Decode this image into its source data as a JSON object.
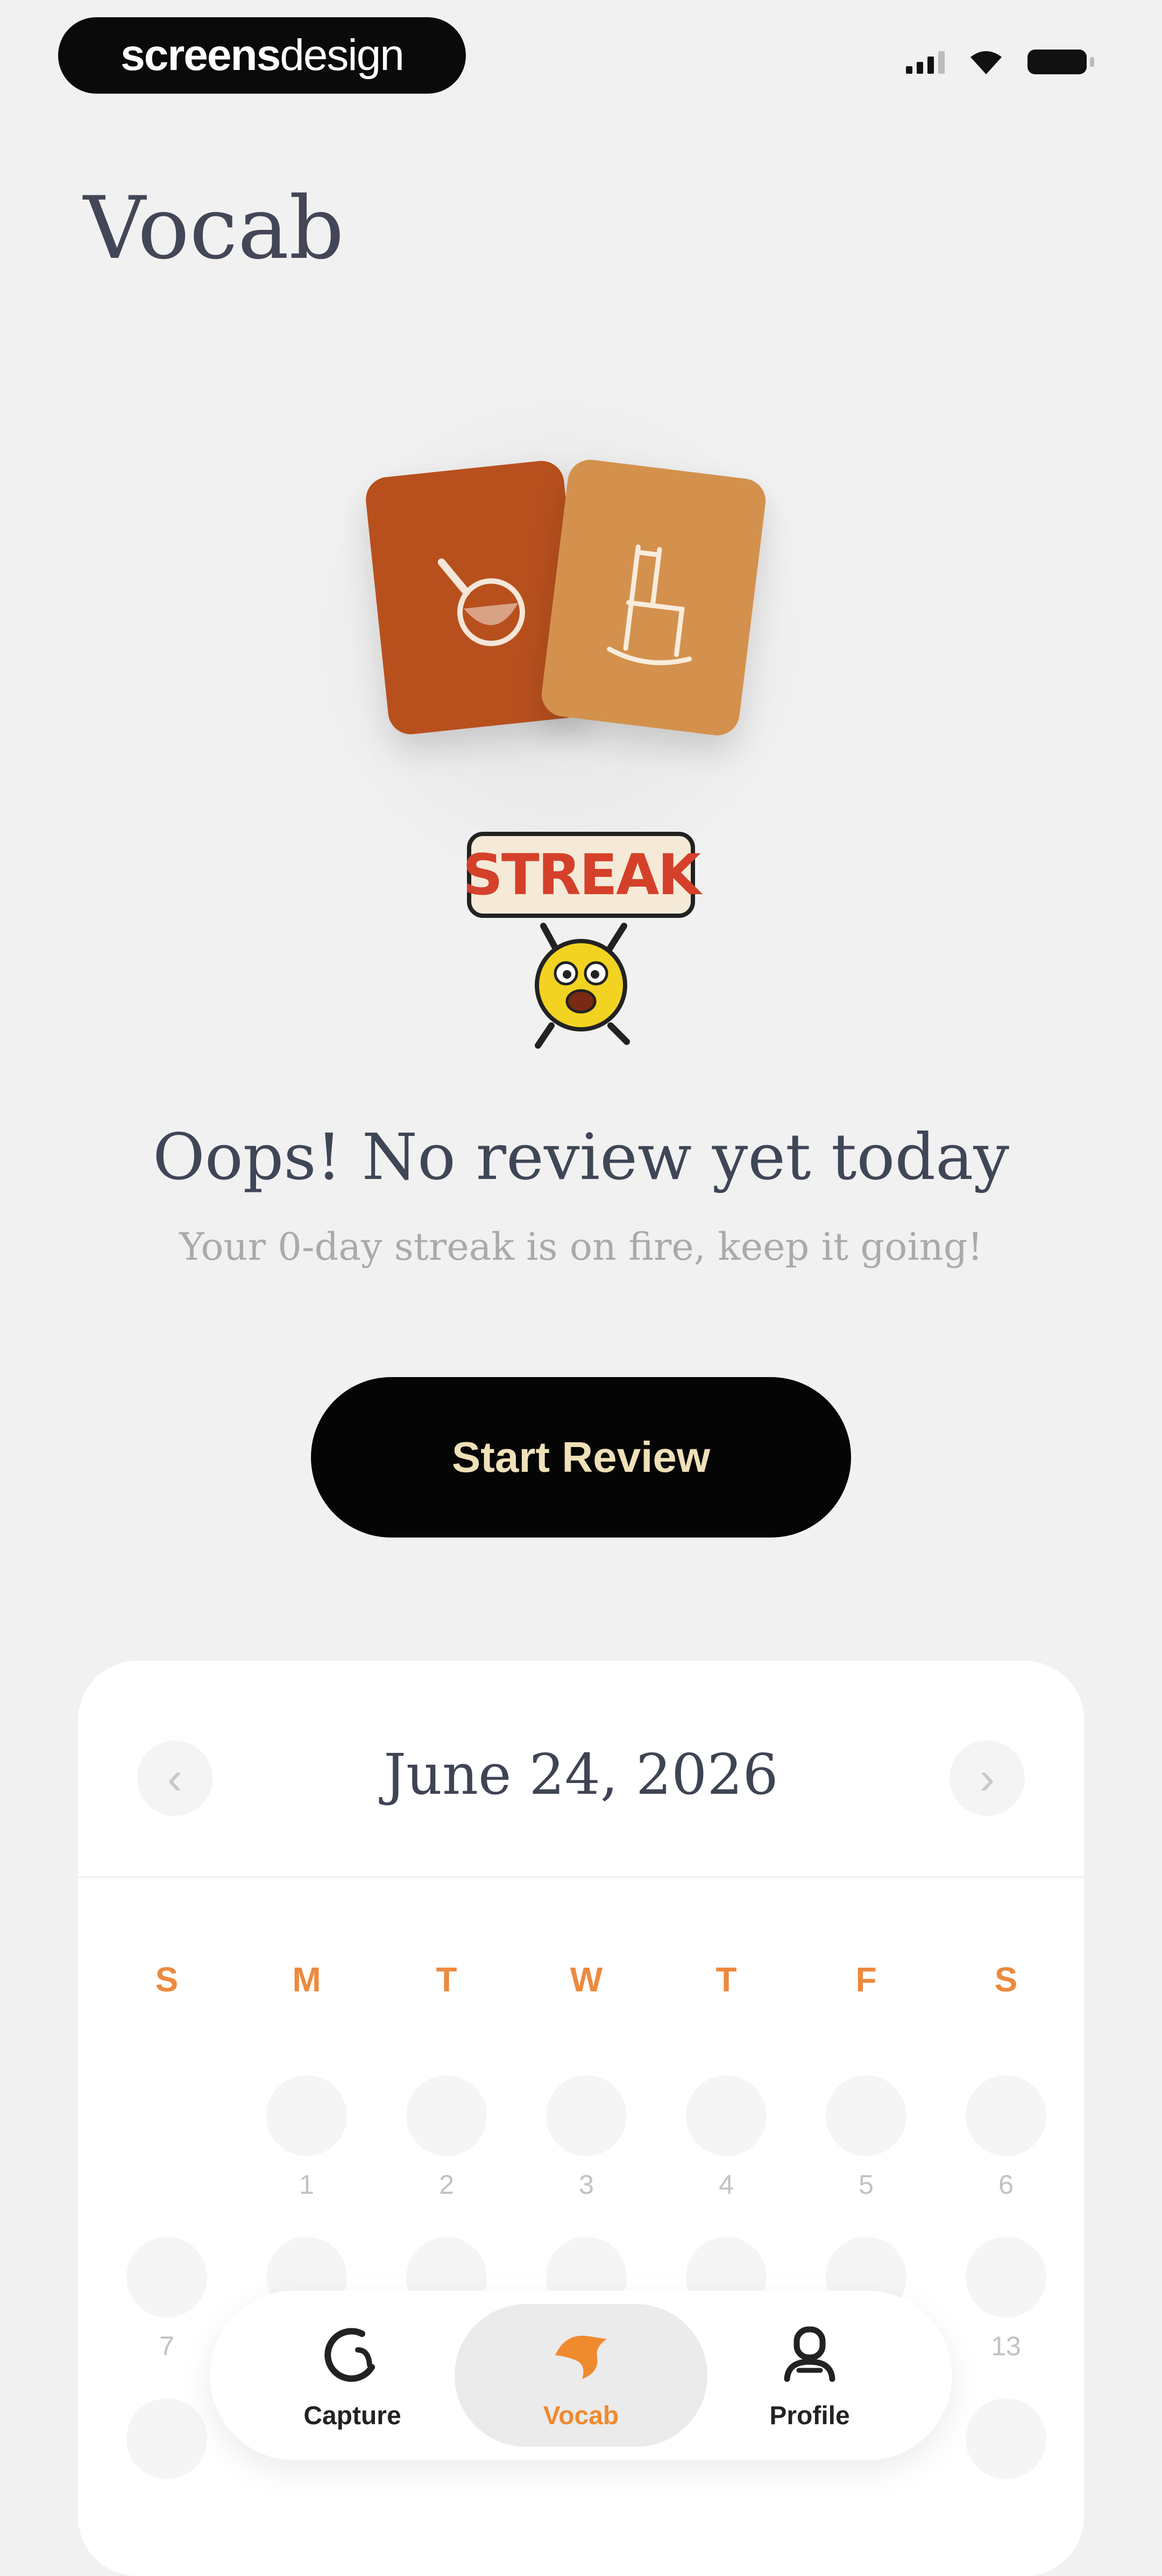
{
  "status_bar": {
    "brand_bold": "screens",
    "brand_light": "design",
    "icons": [
      "signal-icon",
      "wifi-icon",
      "battery-icon"
    ]
  },
  "page": {
    "title": "Vocab"
  },
  "illustration": {
    "cards": [
      "pan-card",
      "chair-card"
    ],
    "streak_label": "STREAK"
  },
  "review": {
    "headline": "Oops! No review yet today",
    "subline": "Your 0-day streak is on fire, keep it going!",
    "start_button": "Start Review"
  },
  "calendar": {
    "month_label": "June 24, 2026",
    "prev_icon": "‹",
    "next_icon": "›",
    "weekdays": [
      "S",
      "M",
      "T",
      "W",
      "T",
      "F",
      "S"
    ],
    "days": [
      "1",
      "2",
      "3",
      "4",
      "5",
      "6",
      "7",
      "13"
    ]
  },
  "tab_bar": {
    "items": [
      {
        "label": "Capture",
        "icon": "capture-icon",
        "active": false
      },
      {
        "label": "Vocab",
        "icon": "vocab-icon",
        "active": true
      },
      {
        "label": "Profile",
        "icon": "profile-icon",
        "active": false
      }
    ]
  },
  "colors": {
    "accent": "#ef8a2f",
    "card_dark": "#b8501e",
    "card_light": "#d3914d",
    "button_bg": "#050505",
    "button_text": "#efe0b8",
    "streak_red": "#d5402b",
    "mascot_yellow": "#f2d321"
  }
}
